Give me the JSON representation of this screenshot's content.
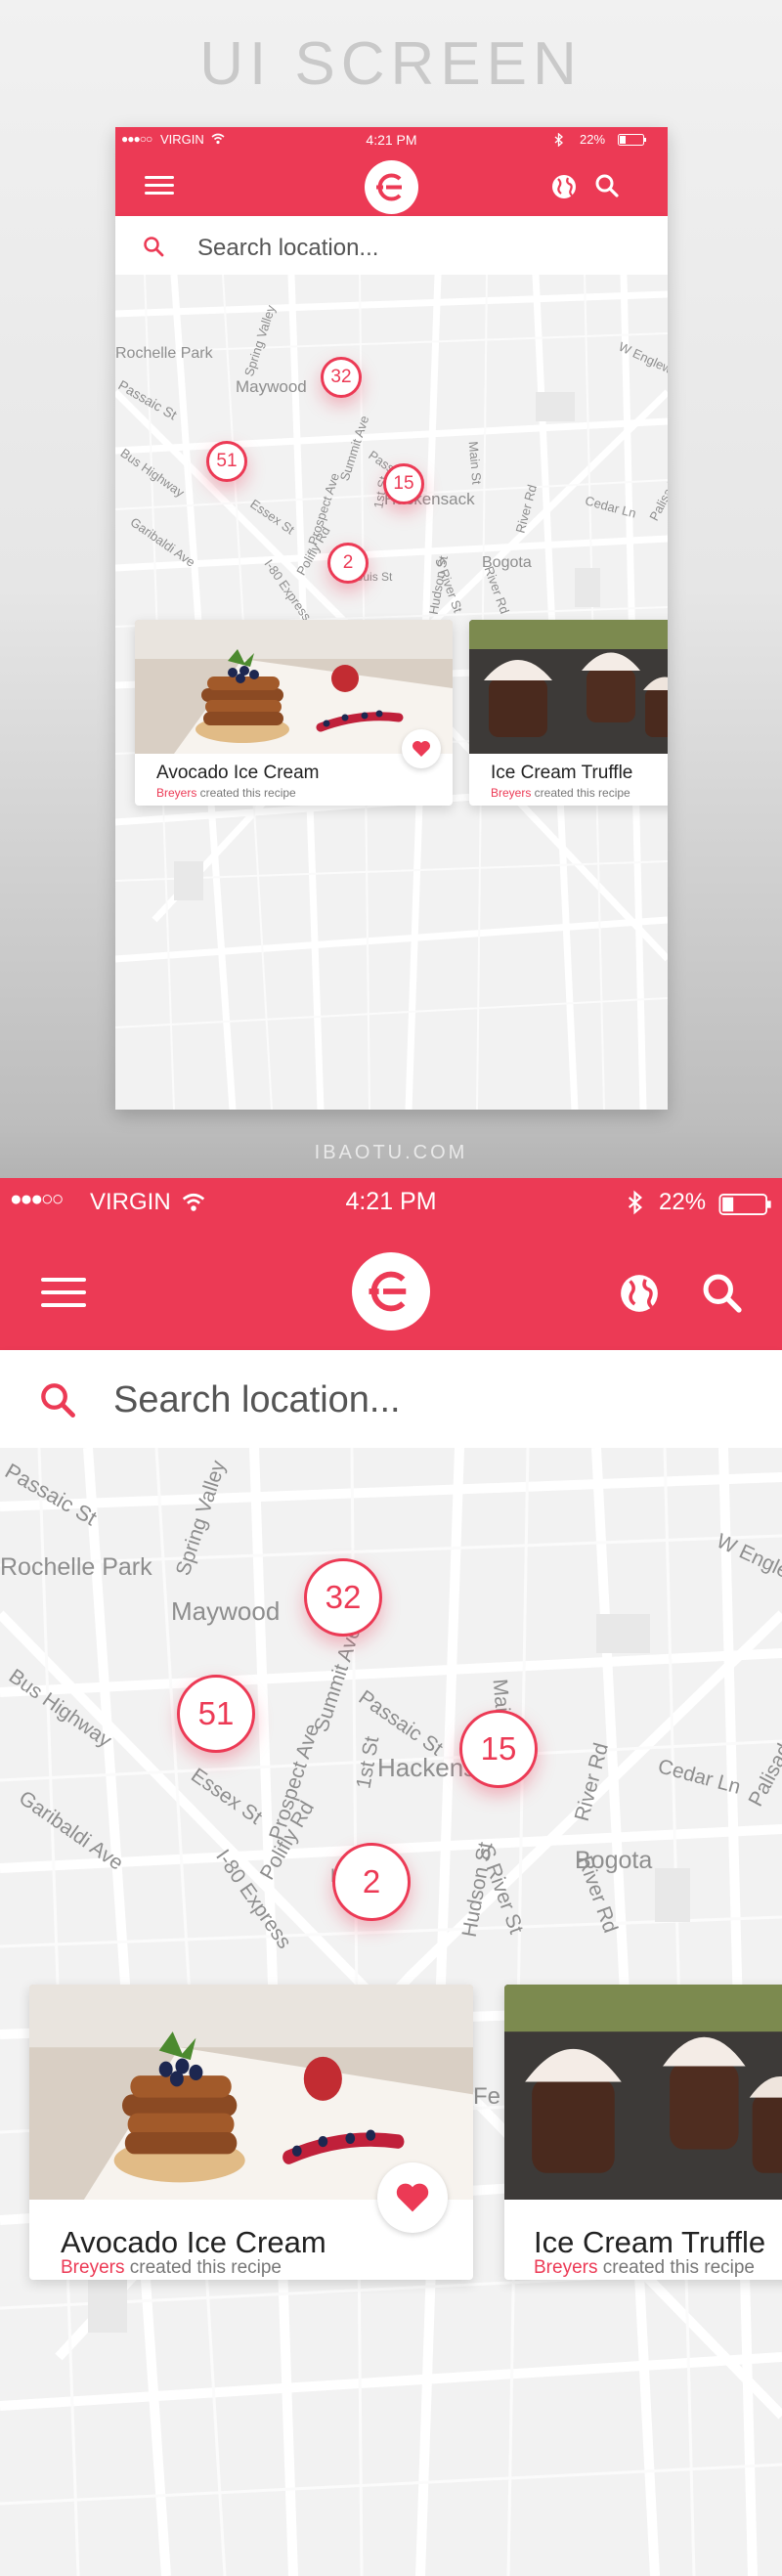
{
  "heading": "UI SCREEN",
  "footer_label": "IBAOTU.COM",
  "status_bar": {
    "carrier": "VIRGIN",
    "time": "4:21 PM",
    "battery": "22%",
    "signal_dots": "●●●○○"
  },
  "search": {
    "placeholder": "Search location..."
  },
  "map": {
    "places": [
      "Rochelle Park",
      "Maywood",
      "Hackensack",
      "Bogota"
    ],
    "streets": [
      "Passaic St",
      "Spring Valley",
      "W Englewood",
      "Bus Highway",
      "Summit Ave",
      "Passaic St",
      "Main St",
      "Cedar Ln",
      "Palisade Ave",
      "Essex St",
      "Prospect Ave",
      "1st St",
      "River Rd",
      "Garibaldi Ave",
      "Polifly Rd",
      "I-80 Express",
      "Louis St",
      "Hudson St",
      "S River St",
      "River Rd",
      "Fe"
    ]
  },
  "clusters": [
    "32",
    "51",
    "15",
    "2"
  ],
  "cards": [
    {
      "title": "Avocado Ice Cream",
      "brand": "Breyers",
      "suffix": " created this recipe",
      "liked": true
    },
    {
      "title": "Ice Cream Truffle",
      "brand": "Breyers",
      "suffix": " created this recipe",
      "liked": false
    }
  ],
  "colors": {
    "accent": "#ec3a55",
    "map_bg": "#f2f2f2",
    "heading": "#c9c9c9"
  },
  "icons": [
    "menu-icon",
    "app-logo-icon",
    "globe-icon",
    "search-icon",
    "wifi-icon",
    "bluetooth-icon",
    "battery-icon",
    "heart-icon"
  ]
}
